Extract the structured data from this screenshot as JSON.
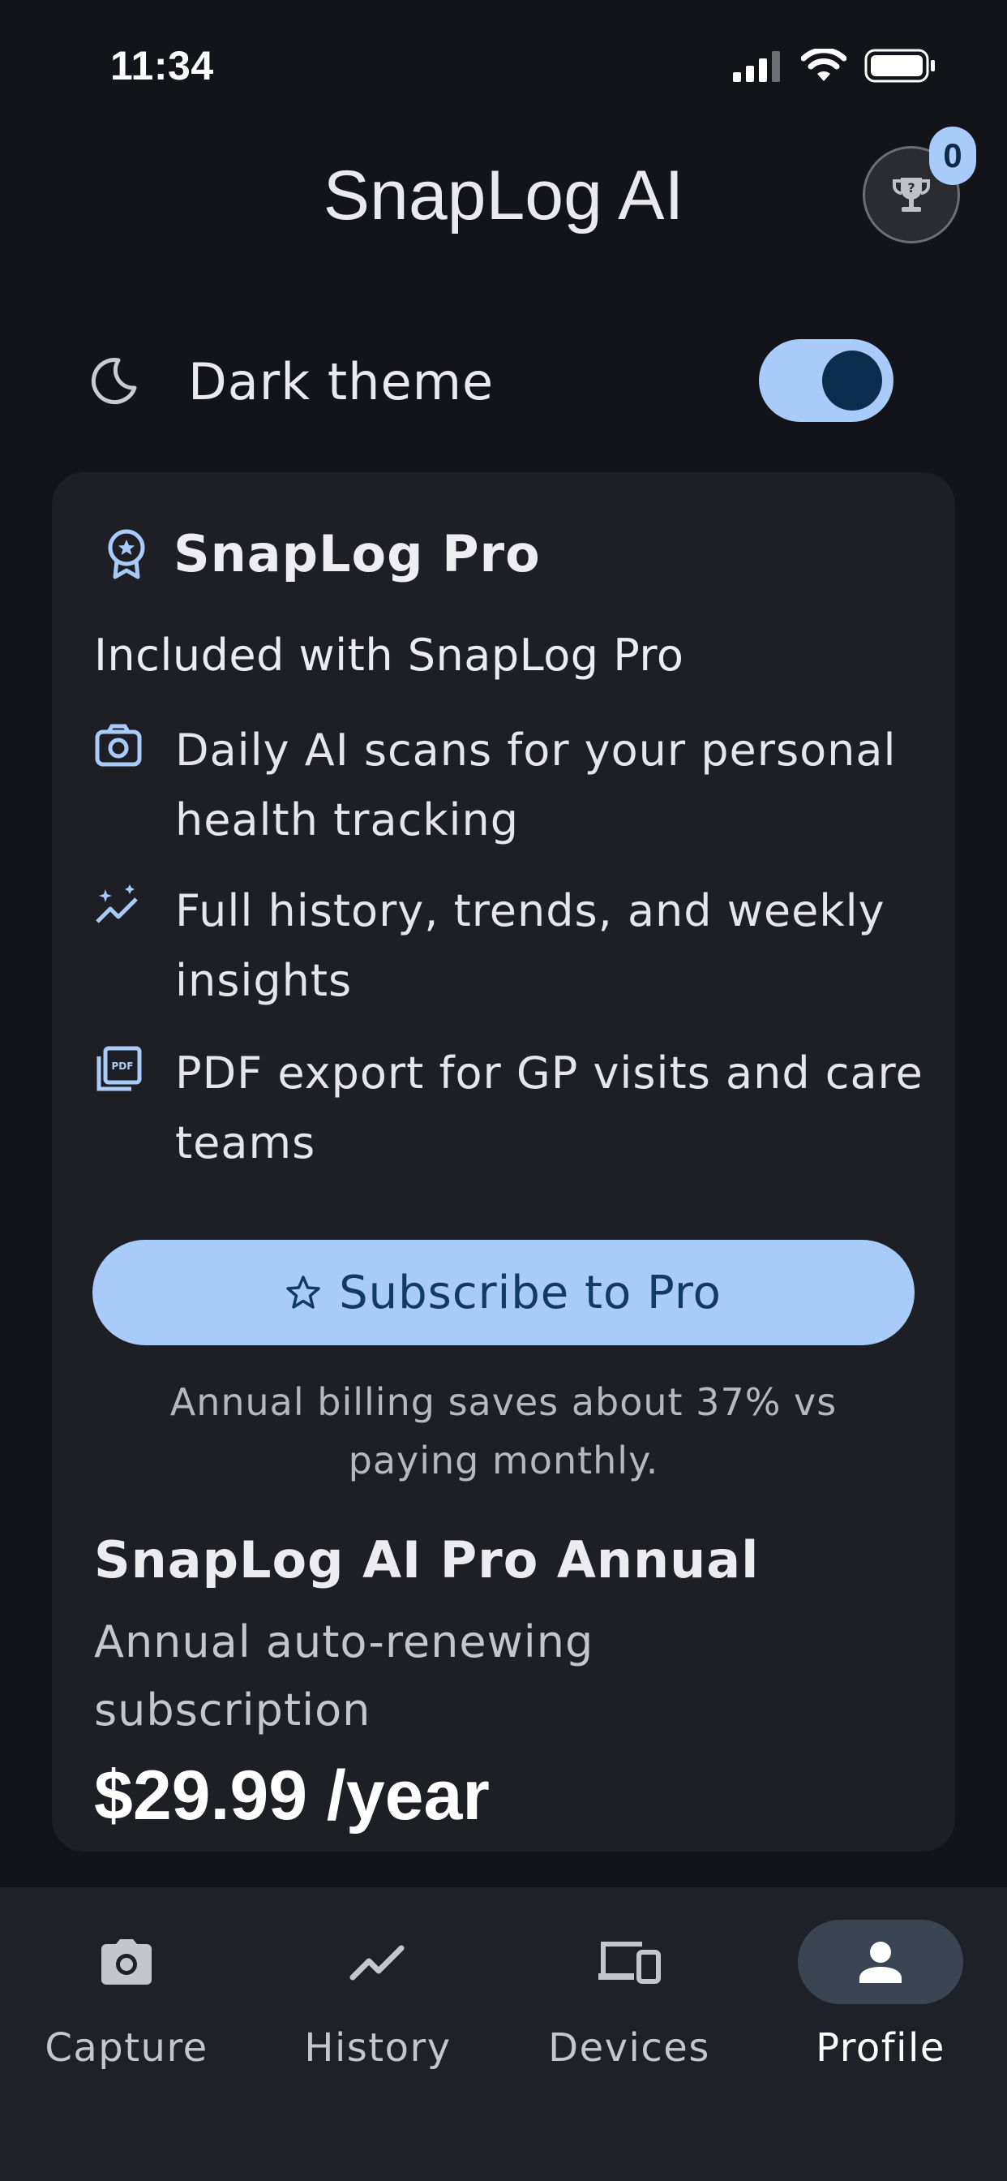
{
  "status_bar": {
    "time": "11:34"
  },
  "header": {
    "title": "SnapLog AI",
    "trophy_count": "0"
  },
  "settings": {
    "dark_theme_label": "Dark theme",
    "dark_theme_enabled": true
  },
  "pro_card": {
    "title": "SnapLog Pro",
    "included_title": "Included with SnapLog Pro",
    "features": [
      {
        "icon": "camera-icon",
        "text": "Daily AI scans for your personal health tracking"
      },
      {
        "icon": "trend-sparkle-icon",
        "text": "Full history, trends, and weekly insights"
      },
      {
        "icon": "pdf-icon",
        "text": "PDF export for GP visits and care teams"
      }
    ],
    "subscribe_label": "Subscribe to Pro",
    "billing_note": "Annual billing saves about 37% vs paying monthly.",
    "plan_name": "SnapLog AI Pro Annual",
    "plan_description": "Annual auto-renewing subscription",
    "plan_price": "$29.99 /year"
  },
  "bottom_nav": {
    "items": [
      {
        "label": "Capture",
        "icon": "camera-icon",
        "active": false
      },
      {
        "label": "History",
        "icon": "trend-icon",
        "active": false
      },
      {
        "label": "Devices",
        "icon": "devices-icon",
        "active": false
      },
      {
        "label": "Profile",
        "icon": "person-icon",
        "active": true
      }
    ]
  },
  "colors": {
    "accent": "#a8cbfa",
    "background": "#121419",
    "card": "#1d1f25",
    "nav": "#1e2127"
  }
}
